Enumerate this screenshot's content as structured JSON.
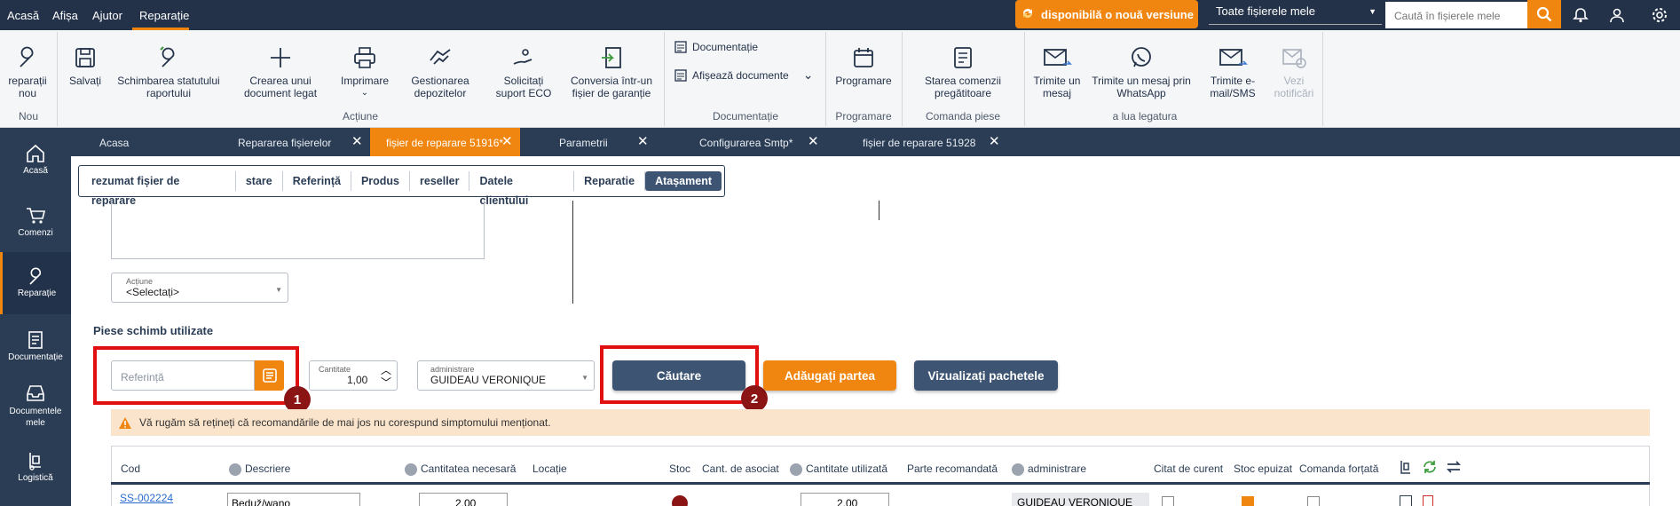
{
  "menubar": {
    "items": [
      "Acasă",
      "Afișa",
      "Ajutor",
      "Reparație"
    ],
    "active": "Reparație"
  },
  "update_notice": "disponibilă o nouă versiune",
  "file_filter": "Toate fișierele mele",
  "search_placeholder": "Caută în fișierele mele",
  "ribbon": {
    "buttons": {
      "new_repair": "reparații nou",
      "save": "Salvați",
      "change_status": "Schimbarea statutului raportului",
      "create_doc": "Crearea unui document legat",
      "print": "Imprimare",
      "manage_deposits": "Gestionarea depozitelor",
      "eco_support": "Solicitați suport ECO",
      "warranty_convert": "Conversia într-un fișier de garanție",
      "documentation": "Documentație",
      "show_documents": "Afișează documente",
      "scheduling": "Programare",
      "parts_order": "Starea comenzii pregătitoare",
      "send_message": "Trimite un mesaj",
      "send_whatsapp": "Trimite un mesaj prin WhatsApp",
      "send_email_sms": "Trimite e-mail/SMS",
      "view_notifications": "Vezi notificări"
    },
    "groups": {
      "new": "Nou",
      "action": "Acțiune",
      "documentation": "Documentație",
      "scheduling": "Programare",
      "parts": "Comanda piese",
      "contact": "a lua legatura"
    }
  },
  "sidebar": [
    {
      "label": "Acasă",
      "icon": "home-icon"
    },
    {
      "label": "Comenzi",
      "icon": "cart-icon"
    },
    {
      "label": "Reparație",
      "icon": "wrench-icon",
      "active": true
    },
    {
      "label": "Documentație",
      "icon": "document-icon"
    },
    {
      "label": "Documentele mele",
      "icon": "inbox-icon"
    },
    {
      "label": "Logistică",
      "icon": "dolly-icon"
    }
  ],
  "tabs": [
    {
      "label": "Acasa"
    },
    {
      "label": "Repararea fișierelor"
    },
    {
      "label": "fișier de reparare 51916*",
      "active": true
    },
    {
      "label": "Parametrii"
    },
    {
      "label": "Configurarea Smtp*"
    },
    {
      "label": "fișier de reparare 51928"
    }
  ],
  "subtabs": [
    "rezumat fișier de reparare",
    "stare",
    "Referință",
    "Produs",
    "reseller",
    "Datele clientului",
    "Reparatie",
    "Atașament"
  ],
  "subtab_active": "Atașament",
  "action_field": {
    "label": "Acțiune",
    "value": "<Selectați>"
  },
  "section_title": "Piese schimb utilizate",
  "reference_placeholder": "Referință",
  "quantity": {
    "label": "Cantitate",
    "value": "1,00"
  },
  "admin_field": {
    "label": "administrare",
    "value": "GUIDEAU VERONIQUE"
  },
  "buttons": {
    "search": "Căutare",
    "add_part": "Adăugați partea",
    "view_packages": "Vizualizați pachetele"
  },
  "markers": [
    "1",
    "2"
  ],
  "warning": "Vă rugăm să rețineți că recomandările de mai jos nu corespund simptomului menționat.",
  "table": {
    "headers": [
      "Cod",
      "Descriere",
      "Cantitatea necesară",
      "Locație",
      "Stoc",
      "Cant. de asociat",
      "Cantitate utilizată",
      "Parte recomandată",
      "administrare",
      "Citat de curent",
      "Stoc epuizat",
      "Comanda forțată"
    ],
    "row": {
      "code": "SS-002224",
      "desc": "Beduž/wano",
      "qty": "2,00",
      "used": "2,00",
      "admin": "GUIDEAU VERONIQUE"
    }
  },
  "colors": {
    "accent": "#f0860f",
    "navy": "#2b3d55",
    "highlight": "#e01010",
    "marker": "#8b1414"
  }
}
